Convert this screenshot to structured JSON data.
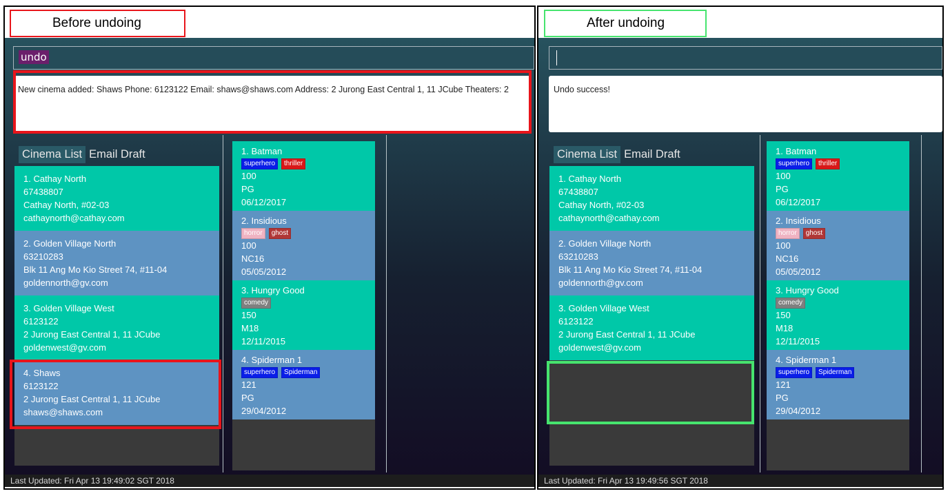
{
  "before": {
    "caption": "Before undoing",
    "command_text": "undo",
    "result_text": "New cinema added: Shaws Phone: 6123122 Email: shaws@shaws.com Address: 2 Jurong East Central 1, 11 JCube Theaters: 2",
    "status": "Last Updated: Fri Apr 13 19:49:02 SGT 2018"
  },
  "after": {
    "caption": "After undoing",
    "command_text": "",
    "result_text": "Undo success!",
    "status": "Last Updated: Fri Apr 13 19:49:56 SGT 2018"
  },
  "tabs": [
    "Cinema List",
    "Email Draft"
  ],
  "cinemas": [
    {
      "name": "1.  Cathay North",
      "phone": "67438807",
      "address": "Cathay North, #02-03",
      "email": "cathaynorth@cathay.com",
      "color": "#00c8a8"
    },
    {
      "name": "2.  Golden Village North",
      "phone": "63210283",
      "address": "Blk 11 Ang Mo Kio Street 74, #11-04",
      "email": "goldennorth@gv.com",
      "color": "#5e93c2"
    },
    {
      "name": "3.  Golden Village West",
      "phone": "6123122",
      "address": "2 Jurong East Central 1, 11 JCube",
      "email": "goldenwest@gv.com",
      "color": "#00c8a8"
    },
    {
      "name": "4.  Shaws",
      "phone": "6123122",
      "address": "2 Jurong East Central 1, 11 JCube",
      "email": "shaws@shaws.com",
      "color": "#5e93c2"
    }
  ],
  "movies": [
    {
      "name": "1.  Batman",
      "tags": [
        {
          "label": "superhero",
          "color": "#0a1ee8"
        },
        {
          "label": "thriller",
          "color": "#d81818"
        }
      ],
      "duration": "100",
      "rating": "PG",
      "date": "06/12/2017",
      "color": "#00c8a8"
    },
    {
      "name": "2.  Insidious",
      "tags": [
        {
          "label": "horror",
          "color": "#f0b3c2"
        },
        {
          "label": "ghost",
          "color": "#b03636"
        }
      ],
      "duration": "100",
      "rating": "NC16",
      "date": "05/05/2012",
      "color": "#5e93c2"
    },
    {
      "name": "3.  Hungry Good",
      "tags": [
        {
          "label": "comedy",
          "color": "#808080"
        }
      ],
      "duration": "150",
      "rating": "M18",
      "date": "12/11/2015",
      "color": "#00c8a8"
    },
    {
      "name": "4.  Spiderman 1",
      "tags": [
        {
          "label": "superhero",
          "color": "#0a1ee8"
        },
        {
          "label": "Spiderman",
          "color": "#0a1ee8"
        }
      ],
      "duration": "121",
      "rating": "PG",
      "date": "29/04/2012",
      "color": "#5e93c2"
    }
  ]
}
